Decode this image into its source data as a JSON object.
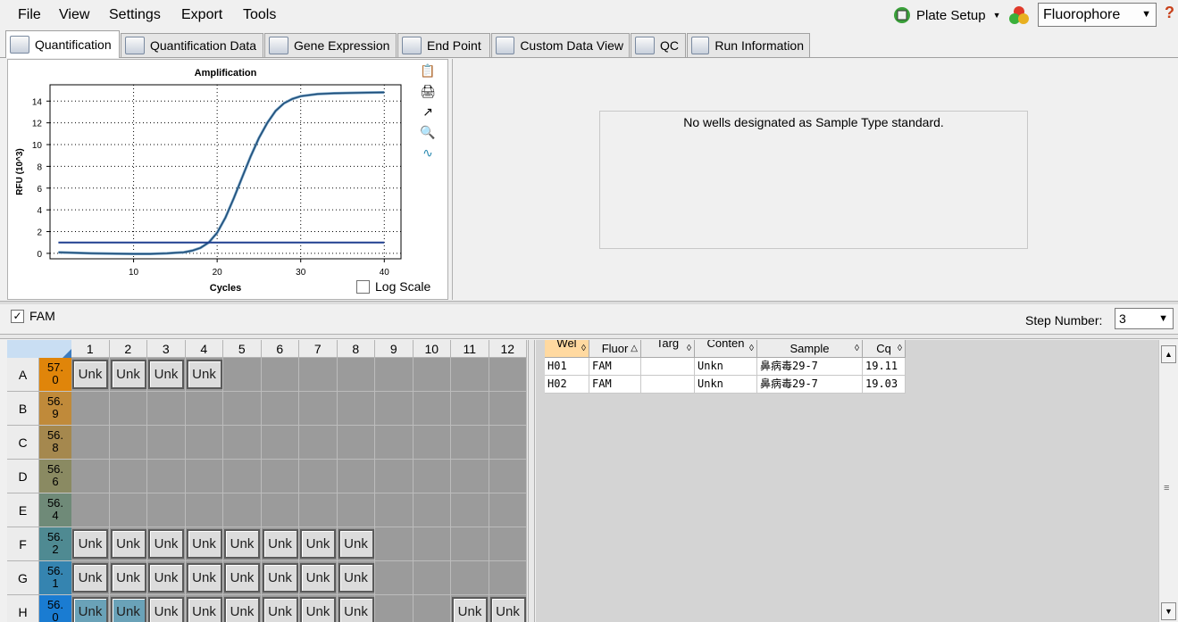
{
  "menu": {
    "items": [
      "File",
      "View",
      "Settings",
      "Export",
      "Tools"
    ]
  },
  "toolbar": {
    "plate_setup": "Plate Setup",
    "fluorophore": "Fluorophore",
    "help": "?"
  },
  "tabs": [
    "Quantification",
    "Quantification Data",
    "Gene Expression",
    "End Point",
    "Custom Data View",
    "QC",
    "Run Information"
  ],
  "chart_data": {
    "type": "line",
    "title": "Amplification",
    "xlabel": "Cycles",
    "ylabel": "RFU (10^3)",
    "xlim": [
      0,
      42
    ],
    "ylim": [
      -0.5,
      15.5
    ],
    "xticks": [
      10,
      20,
      30,
      40
    ],
    "yticks": [
      0,
      2,
      4,
      6,
      8,
      10,
      12,
      14
    ],
    "grid": true,
    "series": [
      {
        "x": [
          1,
          5,
          10,
          12,
          14,
          15,
          16,
          17,
          18,
          19,
          20,
          21,
          22,
          23,
          24,
          25,
          26,
          27,
          28,
          29,
          30,
          32,
          34,
          36,
          38,
          40
        ],
        "y": [
          0.1,
          0,
          -0.05,
          -0.05,
          0,
          0.05,
          0.1,
          0.25,
          0.5,
          1.0,
          1.9,
          3.3,
          5.1,
          7.0,
          8.9,
          10.6,
          12.0,
          13.1,
          13.8,
          14.2,
          14.45,
          14.65,
          14.72,
          14.75,
          14.78,
          14.8
        ],
        "color": "#1f4e79"
      },
      {
        "x": [
          1,
          40
        ],
        "y": [
          1.0,
          1.0
        ],
        "color": "#1f3f8f"
      }
    ]
  },
  "chart_options": {
    "log_scale": "Log Scale",
    "log_scale_checked": false
  },
  "standard_curve": {
    "message": "No wells designated as Sample Type standard."
  },
  "fluor_filter": {
    "label": "FAM",
    "checked": true
  },
  "step": {
    "label": "Step Number:",
    "value": "3"
  },
  "plate": {
    "columns": [
      "1",
      "2",
      "3",
      "4",
      "5",
      "6",
      "7",
      "8",
      "9",
      "10",
      "11",
      "12"
    ],
    "rows": [
      {
        "label": "A",
        "temp": "57.\n0",
        "color": "#e0850a",
        "wells": {
          "1": "Unk",
          "2": "Unk",
          "3": "Unk",
          "4": "Unk"
        }
      },
      {
        "label": "B",
        "temp": "56.\n9",
        "color": "#c08a3a",
        "wells": {}
      },
      {
        "label": "C",
        "temp": "56.\n8",
        "color": "#a5884e",
        "wells": {}
      },
      {
        "label": "D",
        "temp": "56.\n6",
        "color": "#8a8a62",
        "wells": {}
      },
      {
        "label": "E",
        "temp": "56.\n4",
        "color": "#6f8a78",
        "wells": {}
      },
      {
        "label": "F",
        "temp": "56.\n2",
        "color": "#4f8a92",
        "wells": {
          "1": "Unk",
          "2": "Unk",
          "3": "Unk",
          "4": "Unk",
          "5": "Unk",
          "6": "Unk",
          "7": "Unk",
          "8": "Unk"
        }
      },
      {
        "label": "G",
        "temp": "56.\n1",
        "color": "#3584b0",
        "wells": {
          "1": "Unk",
          "2": "Unk",
          "3": "Unk",
          "4": "Unk",
          "5": "Unk",
          "6": "Unk",
          "7": "Unk",
          "8": "Unk"
        }
      },
      {
        "label": "H",
        "temp": "56.\n0",
        "color": "#1a7cd2",
        "wells": {
          "1": "Unk",
          "2": "Unk",
          "3": "Unk",
          "4": "Unk",
          "5": "Unk",
          "6": "Unk",
          "7": "Unk",
          "8": "Unk",
          "11": "Unk",
          "12": "Unk"
        },
        "selected": [
          "1",
          "2"
        ]
      }
    ]
  },
  "data_table": {
    "headers": [
      "Wel\nl",
      "Fluor",
      "Targ\net",
      "Conten\nt",
      "Sample",
      "Cq"
    ],
    "rows": [
      [
        "H01",
        "FAM",
        "",
        "Unkn",
        "鼻病毒29-7",
        "19.11"
      ],
      [
        "H02",
        "FAM",
        "",
        "Unkn",
        "鼻病毒29-7",
        "19.03"
      ]
    ]
  }
}
